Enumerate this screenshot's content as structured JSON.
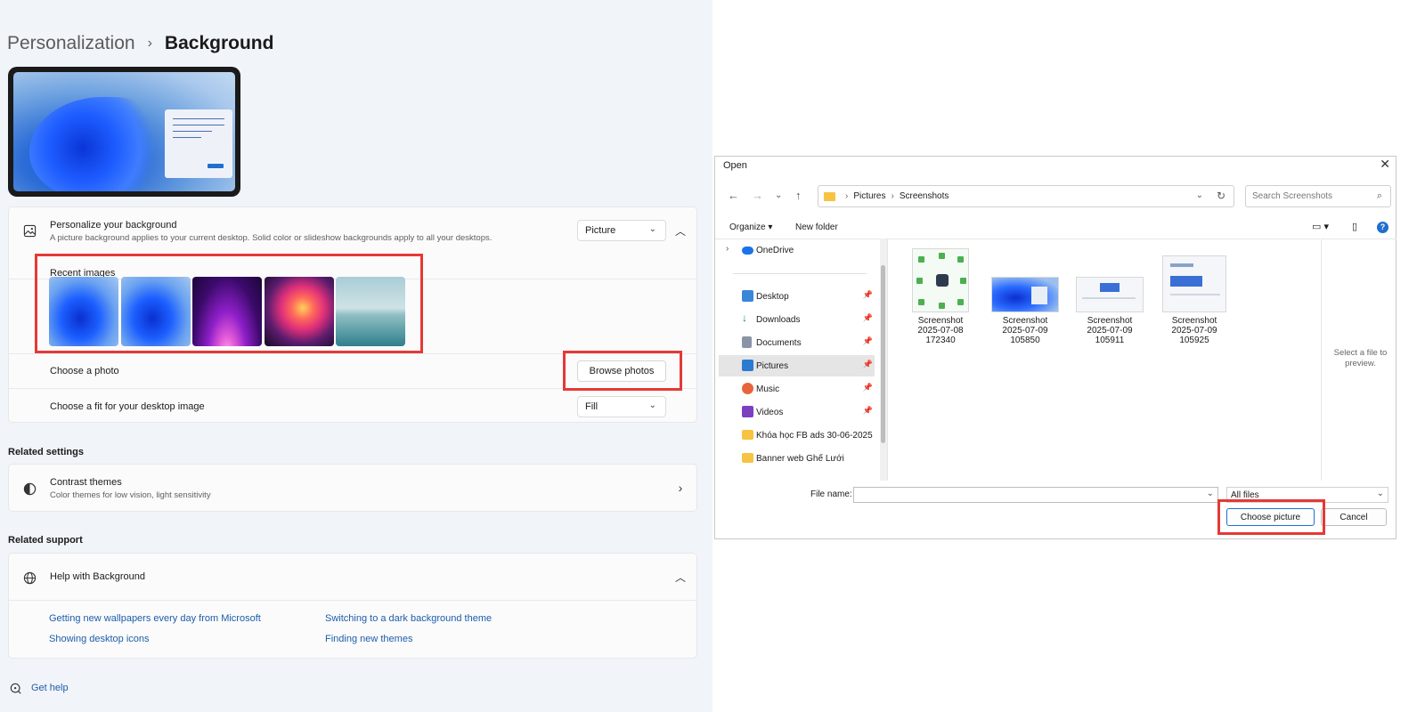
{
  "breadcrumb": {
    "parent": "Personalization",
    "separator": "›",
    "current": "Background"
  },
  "personalize": {
    "title": "Personalize your background",
    "subtitle": "A picture background applies to your current desktop. Solid color or slideshow backgrounds apply to all your desktops.",
    "dropdown_value": "Picture"
  },
  "recent": {
    "label": "Recent images"
  },
  "choose_photo": {
    "label": "Choose a photo",
    "button": "Browse photos"
  },
  "fit": {
    "label": "Choose a fit for your desktop image",
    "value": "Fill"
  },
  "related_settings": {
    "heading": "Related settings",
    "contrast_title": "Contrast themes",
    "contrast_sub": "Color themes for low vision, light sensitivity"
  },
  "related_support": {
    "heading": "Related support",
    "help_title": "Help with Background",
    "links": [
      "Getting new wallpapers every day from Microsoft",
      "Switching to a dark background theme",
      "Showing desktop icons",
      "Finding new themes"
    ]
  },
  "get_help": "Get help",
  "dialog": {
    "title": "Open",
    "close": "✕",
    "path": [
      "Pictures",
      "Screenshots"
    ],
    "search_placeholder": "Search Screenshots",
    "organize": "Organize ▾",
    "new_folder": "New folder",
    "nav": [
      {
        "label": "OneDrive"
      },
      {
        "label": "Desktop"
      },
      {
        "label": "Downloads"
      },
      {
        "label": "Documents"
      },
      {
        "label": "Pictures"
      },
      {
        "label": "Music"
      },
      {
        "label": "Videos"
      },
      {
        "label": "Khóa học FB ads 30-06-2025"
      },
      {
        "label": "Banner web Ghế Lưới"
      }
    ],
    "files": [
      {
        "name1": "Screenshot",
        "name2": "2025-07-08",
        "name3": "172340"
      },
      {
        "name1": "Screenshot",
        "name2": "2025-07-09",
        "name3": "105850"
      },
      {
        "name1": "Screenshot",
        "name2": "2025-07-09",
        "name3": "105911"
      },
      {
        "name1": "Screenshot",
        "name2": "2025-07-09",
        "name3": "105925"
      }
    ],
    "preview_message": "Select a file to preview.",
    "file_name_label": "File name:",
    "file_type": "All files",
    "choose_button": "Choose picture",
    "cancel_button": "Cancel"
  },
  "colors": {
    "highlight": "#e53935",
    "accent": "#1f6fce",
    "link": "#1d5da8"
  }
}
